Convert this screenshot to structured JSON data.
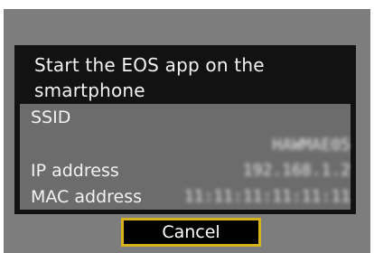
{
  "dialog": {
    "message_line1": "Start the EOS app on the",
    "message_line2": "smartphone"
  },
  "info": {
    "ssid_label": "SSID",
    "ssid_value": "HAWMAE05",
    "ip_label": "IP address",
    "ip_value": "192.168.1.2",
    "mac_label": "MAC address",
    "mac_value": "11:11:11:11:11:11"
  },
  "actions": {
    "cancel_label": "Cancel"
  }
}
